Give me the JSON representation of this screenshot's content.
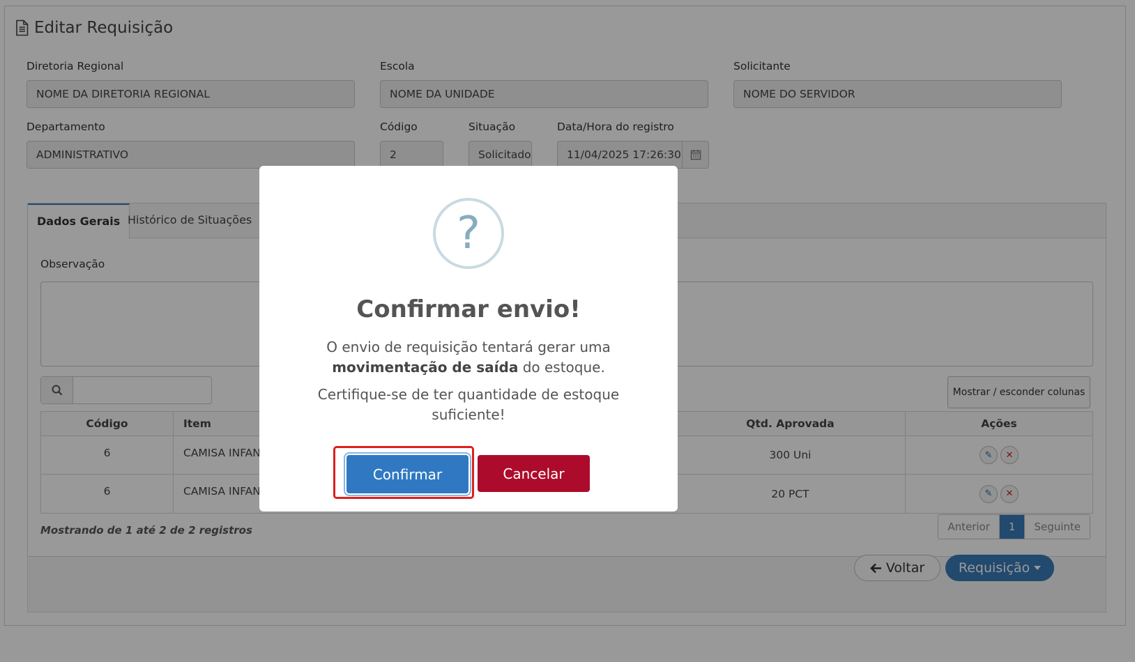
{
  "page": {
    "title": "Editar Requisição"
  },
  "form": {
    "diretoria_label": "Diretoria Regional",
    "diretoria_value": "NOME DA DIRETORIA REGIONAL",
    "escola_label": "Escola",
    "escola_value": "NOME DA UNIDADE",
    "solicitante_label": "Solicitante",
    "solicitante_value": "NOME DO SERVIDOR",
    "departamento_label": "Departamento",
    "departamento_value": "ADMINISTRATIVO",
    "codigo_label": "Código",
    "codigo_value": "2",
    "situacao_label": "Situação",
    "situacao_value": "Solicitado",
    "datahora_label": "Data/Hora do registro",
    "datahora_value": "11/04/2025 17:26:30"
  },
  "tabs": [
    {
      "label": "Dados Gerais",
      "active": true
    },
    {
      "label": "Histórico de Situações",
      "active": false
    }
  ],
  "observacao_label": "Observação",
  "toggle_columns_label": "Mostrar / esconder colunas",
  "table": {
    "headers": {
      "codigo": "Código",
      "item": "Item",
      "qtd_aprovada": "Qtd. Aprovada",
      "acoes": "Ações"
    },
    "rows": [
      {
        "codigo": "6",
        "item": "CAMISA INFANTIL",
        "qtd_aprovada": "300 Uni"
      },
      {
        "codigo": "6",
        "item": "CAMISA INFANTIL",
        "qtd_aprovada": "20 PCT"
      }
    ]
  },
  "info_text": "Mostrando de 1 até 2 de 2 registros",
  "pagination": {
    "prev": "Anterior",
    "current": "1",
    "next": "Seguinte"
  },
  "footer": {
    "voltar_label": "Voltar",
    "requisicao_label": "Requisição"
  },
  "modal": {
    "icon_char": "?",
    "title": "Confirmar envio!",
    "text_part1": "O envio de requisição tentará gerar uma",
    "text_bold": "movimentação de saída",
    "text_part2": "do estoque.",
    "text_line2": "Certifique-se de ter quantidade de estoque suficiente!",
    "confirm_label": "Confirmar",
    "cancel_label": "Cancelar"
  },
  "colors": {
    "primary": "#3079c2",
    "danger": "#ad0b2b",
    "focus_highlight": "#e01e1e",
    "overlay": "rgba(0,0,0,0.40)"
  }
}
